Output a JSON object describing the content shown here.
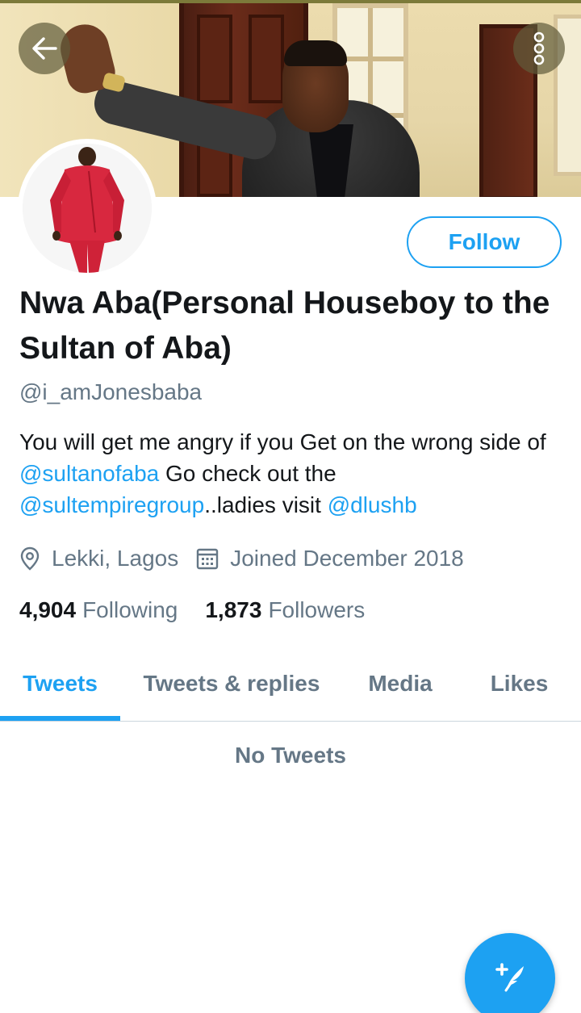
{
  "header": {
    "back_icon": "arrow-left-icon",
    "more_icon": "more-vertical-icon",
    "banner_image": "header-photo"
  },
  "profile": {
    "avatar_image": "profile-photo",
    "follow_label": "Follow",
    "display_name": "Nwa Aba(Personal Houseboy to the Sultan of Aba)",
    "handle": "@i_amJonesbaba",
    "bio": {
      "part1": "You will get me angry if you Get on the wrong side of ",
      "mention1": "@sultanofaba",
      "part2": " Go check out the ",
      "mention2": "@sultempiregroup",
      "part3": "..ladies visit ",
      "mention3": "@dlushb"
    },
    "location_icon": "location-pin-icon",
    "location": "Lekki, Lagos",
    "calendar_icon": "calendar-icon",
    "joined": "Joined December 2018",
    "following_count": "4,904",
    "following_label": "Following",
    "followers_count": "1,873",
    "followers_label": "Followers"
  },
  "tabs": [
    {
      "label": "Tweets",
      "active": true
    },
    {
      "label": "Tweets & replies",
      "active": false
    },
    {
      "label": "Media",
      "active": false
    },
    {
      "label": "Likes",
      "active": false
    }
  ],
  "empty_state": "No Tweets",
  "fab": {
    "icon": "compose-tweet-icon"
  },
  "colors": {
    "accent": "#1da1f2",
    "secondary_text": "#657786",
    "primary_text": "#14171a",
    "divider": "#ccd6dd"
  }
}
